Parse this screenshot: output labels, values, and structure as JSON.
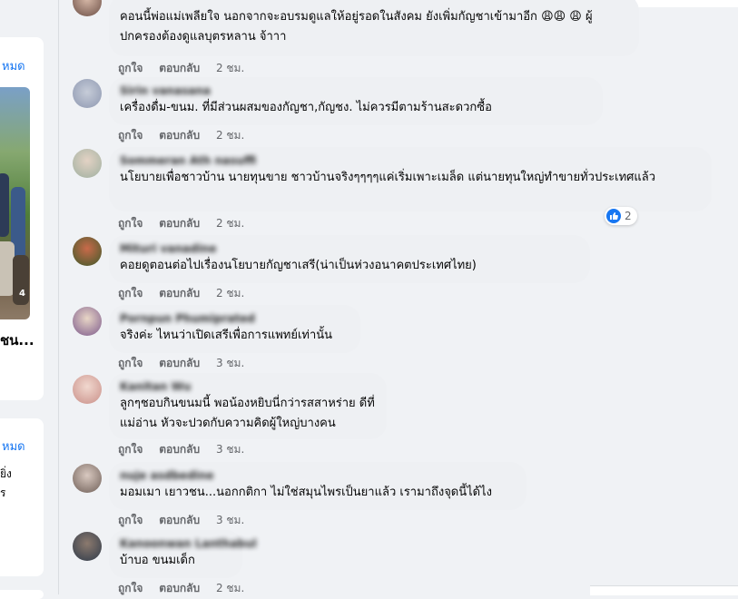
{
  "left": {
    "see_all_1": "หมด",
    "see_all_2": "หมด",
    "card_title": "ชน...",
    "photo_badge": "4",
    "snip_1": "ยิ่ง",
    "snip_2": "ร"
  },
  "actions": {
    "like": "ถูกใจ",
    "reply": "ตอบกลับ"
  },
  "comments": [
    {
      "author": "",
      "text": "คอนนี้พ่อแม่เพลียใจ นอกจากจะอบรมดูแลให้อยู่รอดในสังคม ยังเพิ่มกัญชาเข้ามาอีก 😩😩 😩 ผู้ปกครองต้องดูแลบุตรหลาน จ้าาา",
      "time": "2 ชม."
    },
    {
      "author": "Sirin vanasana",
      "text": "เครื่องดื่ม-ขนม. ที่มีส่วนผสมของกัญชา,กัญชง. ไม่ควรมีตามร้านสะดวกซื้อ",
      "time": "2 ชม."
    },
    {
      "author": "Sommeran Ath nasuffi",
      "text": "นโยบายเพื่อชาวบ้าน นายทุนขาย ชาวบ้านจริงๆๆๆๆแค่เริ่มเพาะเมล็ด แต่นายทุนใหญ่ทำขายทั่วประเทศแล้ว",
      "time": "2 ชม.",
      "reactions": "2"
    },
    {
      "author": "Mituri vanadine",
      "text": "คอยดูตอนต่อไปเรื่องนโยบายกัญชาเสรี(น่าเป็นห่วงอนาคตประเทศไทย)",
      "time": "2 ชม."
    },
    {
      "author": "Pornpun Phumiprated",
      "text": "จริงค่ะ ไหนว่าเปิดเสรีเพื่อการแพทย์เท่านั้น",
      "time": "3 ชม."
    },
    {
      "author": "Kanitan Wu",
      "text": "ลูกๆชอบกินขนมนี้ พอน้องหยิบนี่กว่ารสสาหร่าย ดีที่แม่อ่าน หัวจะปวดกับความคิดผู้ใหญ่บางคน",
      "time": "3 ชม."
    },
    {
      "author": "nuje asdbedine",
      "text": "มอมเมา เยาวชน...นอกกติกา ไม่ใช่สมุนไพรเป็นยาแล้ว เรามาถึงจุดนี้ได้ไง",
      "time": "3 ชม."
    },
    {
      "author": "Kanoonwan Lanthabul",
      "text": "บ้าบอ ขนมเด็ก",
      "time": "2 ชม."
    }
  ]
}
